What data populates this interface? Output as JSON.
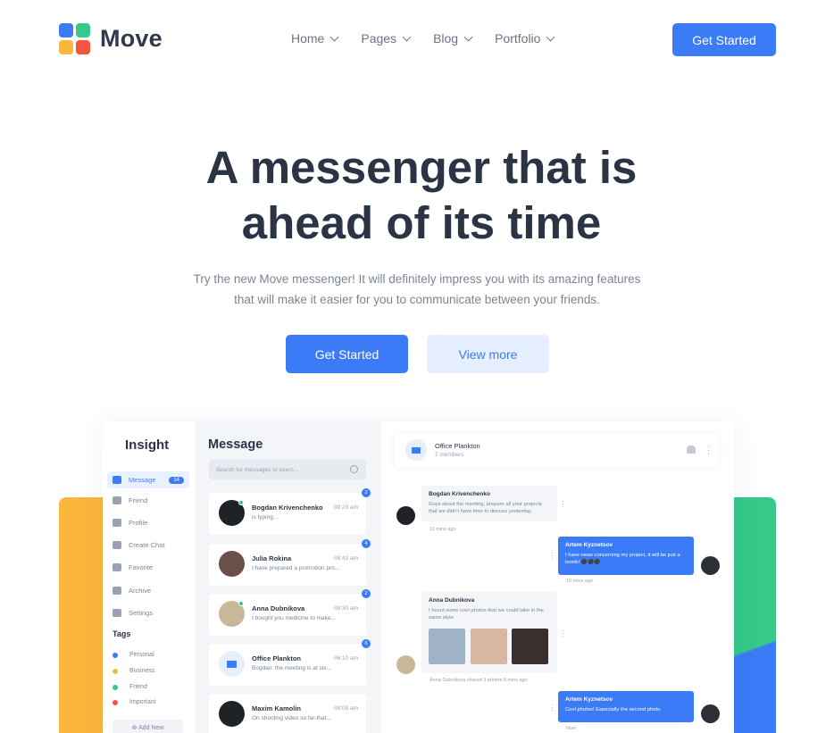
{
  "brand": {
    "name": "Move",
    "colors": {
      "primary": "#3b7bf8",
      "green": "#36c98a",
      "yellow": "#fbb63c",
      "red": "#f2563f"
    }
  },
  "nav": {
    "items": [
      {
        "label": "Home"
      },
      {
        "label": "Pages"
      },
      {
        "label": "Blog"
      },
      {
        "label": "Portfolio"
      }
    ],
    "cta": "Get Started"
  },
  "hero": {
    "headline_line1": "A messenger that is",
    "headline_line2": "ahead of its time",
    "sub_line1": "Try the new Move messenger! It will definitely impress you with its amazing features",
    "sub_line2": "that will make it easier for you to communicate between your friends.",
    "primary_cta": "Get Started",
    "secondary_cta": "View more"
  },
  "app": {
    "sidebar": {
      "title": "Insight",
      "items": [
        {
          "label": "Message",
          "badge": "14",
          "icon": "mail-icon"
        },
        {
          "label": "Friend",
          "icon": "friend-icon"
        },
        {
          "label": "Profile",
          "icon": "profile-icon"
        },
        {
          "label": "Create Chat",
          "icon": "create-chat-icon"
        },
        {
          "label": "Favorite",
          "icon": "star-icon"
        },
        {
          "label": "Archive",
          "icon": "archive-icon"
        },
        {
          "label": "Settings",
          "icon": "gear-icon"
        }
      ],
      "tags_title": "Tags",
      "tags": [
        {
          "label": "Personal",
          "color": "#3b7bf8"
        },
        {
          "label": "Business",
          "color": "#fbb63c"
        },
        {
          "label": "Friend",
          "color": "#36c98a"
        },
        {
          "label": "Important",
          "color": "#f2563f"
        }
      ],
      "add_new": "⊕ Add New"
    },
    "messages": {
      "title": "Message",
      "search_placeholder": "Search for messages or users...",
      "conversations": [
        {
          "name": "Bogdan Krivenchenko",
          "time": "09:20 am",
          "snippet": "is typing...",
          "count": "2"
        },
        {
          "name": "Julia Rokina",
          "time": "08:43 am",
          "snippet": "I have prepared a promotion pro...",
          "count": "4"
        },
        {
          "name": "Anna Dubnikova",
          "time": "08:30 am",
          "snippet": "I bought you medicine to make...",
          "count": "2"
        },
        {
          "name": "Office Plankton",
          "time": "06:10 am",
          "snippet": "Bogdan: the meeting is at six...",
          "count": "6"
        },
        {
          "name": "Maxim Kamolin",
          "time": "08:08 am",
          "snippet": "On shooting video so far-that...",
          "count": ""
        }
      ]
    },
    "chat": {
      "title": "Office Plankton",
      "subtitle": "7 members",
      "messages": [
        {
          "name": "Bogdan Krivenchenko",
          "text1": "Guys about the meeting, prepare all your projects",
          "text2": "that we didn't have time to discuss yesterday.",
          "meta": "11 mins ago"
        },
        {
          "name": "Artem Kyznetsov",
          "text1": "I have news concerning my project, it will be just a",
          "text2": "bomb! ⚫⚫⚫",
          "meta": "10 mins ago"
        },
        {
          "name": "Anna Dubnikova",
          "text1": "I found some cool photos that we could take in the",
          "text2": "same style.",
          "meta": "Anna Dubnikova shared 3 photos 8 mins ago"
        },
        {
          "name": "Artem Kyznetsov",
          "text1": "Cool photos! Especially the second photo.",
          "meta": "Now"
        }
      ]
    }
  }
}
